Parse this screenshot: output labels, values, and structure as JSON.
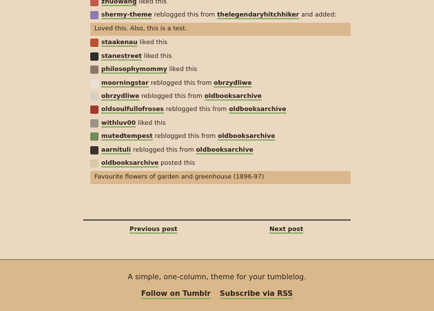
{
  "notes": [
    {
      "type": "note",
      "user": "zhuowang",
      "action": "liked this",
      "avatar_color": "#c25a4a"
    },
    {
      "type": "note",
      "user": "shermy-theme",
      "action": "reblogged this from",
      "target": "thelegendaryhitchhiker",
      "suffix": "and added:",
      "avatar_color": "#8c7bb0"
    },
    {
      "type": "quote",
      "text": "Loved this. Also, this is a test."
    },
    {
      "type": "note",
      "user": "staakenau",
      "action": "liked this",
      "avatar_color": "#b8522e"
    },
    {
      "type": "note",
      "user": "stanestreet",
      "action": "liked this",
      "avatar_color": "#2c2c2c"
    },
    {
      "type": "note",
      "user": "philosophymommy",
      "action": "liked this",
      "avatar_color": "#8a7a66"
    },
    {
      "type": "note",
      "user": "moorningstar",
      "action": "reblogged this from",
      "target": "obrzydliwe",
      "avatar_color": "#e7e1d8"
    },
    {
      "type": "note",
      "user": "obrzydliwe",
      "action": "reblogged this from",
      "target": "oldbooksarchive",
      "avatar_color": "#d8cfc3"
    },
    {
      "type": "note",
      "user": "oldsoulfullofroses",
      "action": "reblogged this from",
      "target": "oldbooksarchive",
      "avatar_color": "#a0392c"
    },
    {
      "type": "note",
      "user": "withluv00",
      "action": "liked this",
      "avatar_color": "#9a9388"
    },
    {
      "type": "note",
      "user": "mutedtempest",
      "action": "reblogged this from",
      "target": "oldbooksarchive",
      "avatar_color": "#6f8c5a"
    },
    {
      "type": "note",
      "user": "aarnituli",
      "action": "reblogged this from",
      "target": "oldbooksarchive",
      "avatar_color": "#3c342c"
    },
    {
      "type": "note",
      "user": "oldbooksarchive",
      "action": "posted this",
      "avatar_color": "#d9c9a6"
    },
    {
      "type": "quote",
      "text": "Favourite flowers of garden and greenhouse (1896-97)"
    }
  ],
  "pagination": {
    "previous": "Previous post",
    "next": "Next post"
  },
  "footer": {
    "tagline": "A simple, one-column, theme for your tumblelog.",
    "follow": "Follow on Tumblr",
    "rss": "Subscribe via RSS"
  }
}
